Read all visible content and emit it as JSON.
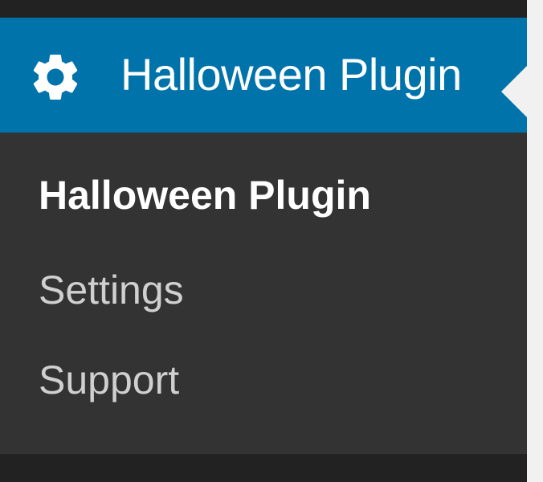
{
  "menu": {
    "active_item": {
      "label": "Halloween Plugin",
      "icon": "gear-icon"
    },
    "submenu": [
      {
        "label": "Halloween Plugin",
        "current": true
      },
      {
        "label": "Settings",
        "current": false
      },
      {
        "label": "Support",
        "current": false
      }
    ]
  },
  "colors": {
    "menu_background": "#222222",
    "submenu_background": "#333333",
    "active_background": "#0073aa",
    "page_background": "#f1f1f1",
    "active_text": "#ffffff",
    "submenu_text": "#d0d0d0"
  }
}
